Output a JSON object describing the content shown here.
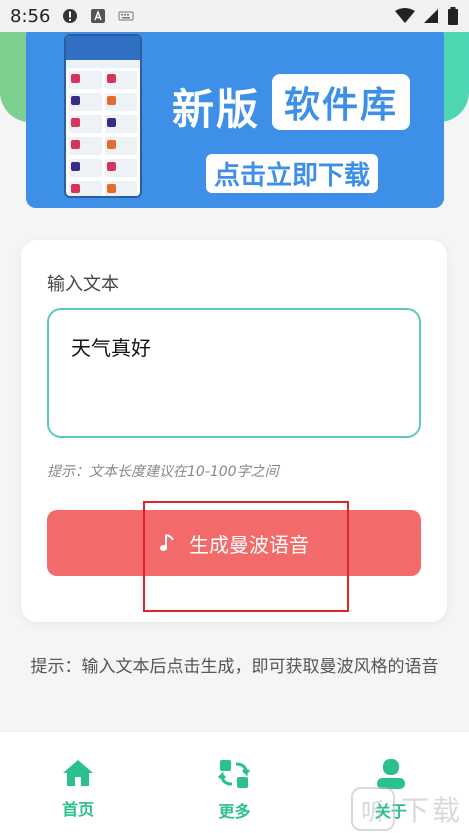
{
  "status_bar": {
    "time": "8:56"
  },
  "banner": {
    "title_new": "新版",
    "title_lib": "软件库",
    "download_label": "点击立即下载"
  },
  "input_card": {
    "label": "输入文本",
    "value": "天气真好",
    "hint": "提示：文本长度建议在10-100字之间",
    "generate_button": "生成曼波语音"
  },
  "tip": "提示：输入文本后点击生成，即可获取曼波风格的语音",
  "bottom_nav": {
    "items": [
      {
        "label": "首页",
        "icon": "home-icon"
      },
      {
        "label": "更多",
        "icon": "refresh-icon"
      },
      {
        "label": "关于",
        "icon": "user-icon"
      }
    ],
    "accent": "#2bc090"
  },
  "watermark": {
    "icon_text": "听",
    "text": "下载"
  },
  "colors": {
    "button": "#f26a6a",
    "input_border": "#5ec8bf",
    "banner": "#3e8fe8"
  }
}
